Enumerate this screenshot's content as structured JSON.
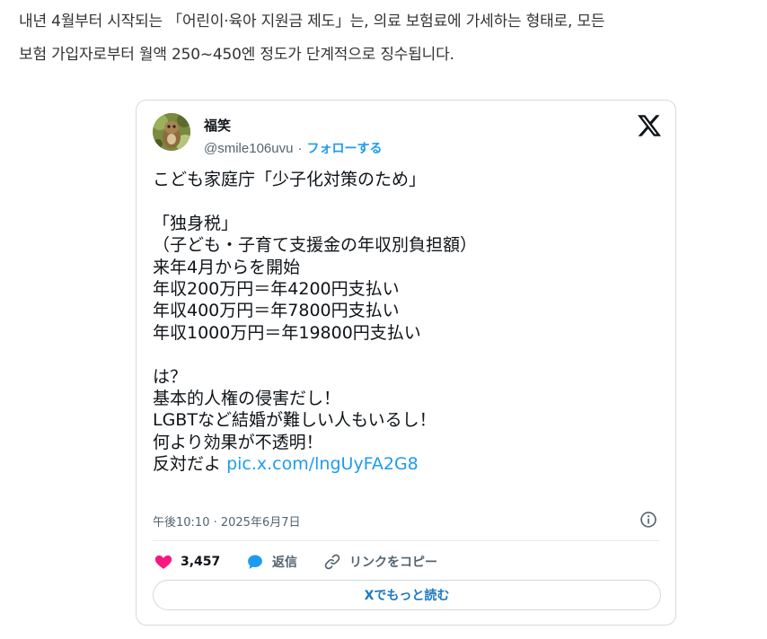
{
  "intro_lines": [
    "내년 4월부터 시작되는 「어린이·육아 지원금 제도」는, 의료 보험료에 가세하는 형태로, 모든",
    "보험 가입자로부터 월액 250~450엔 정도가 단계적으로 징수됩니다."
  ],
  "tweet": {
    "author": {
      "display_name": "福笑",
      "handle": "@smile106uvu",
      "separator": "·",
      "follow_label": "フォローする"
    },
    "platform_icon": "x-logo-icon",
    "lines": [
      "こども家庭庁「少子化対策のため」",
      "",
      "「独身税」",
      "（子ども・子育て支援金の年収別負担額）",
      "来年4月からを開始",
      "年収200万円＝年4200円支払い",
      "年収400万円＝年7800円支払い",
      "年収1000万円＝年19800円支払い",
      "",
      "は？",
      "基本的人権の侵害だし！",
      "LGBTなど結婚が難しい人もいるし！",
      "何より効果が不透明！"
    ],
    "last_line_text": "反対だよ",
    "link_text": "pic.x.com/lngUyFA2G8",
    "timestamp": "午後10:10 · 2025年6月7日",
    "actions": {
      "like_count": "3,457",
      "reply_label": "返信",
      "copy_link_label": "リンクをコピー"
    },
    "read_more_label": "Xでもっと読む"
  },
  "colors": {
    "like": "#f91880",
    "reply": "#1d9bf0",
    "link": "#1d9bf0",
    "muted": "#536471"
  }
}
